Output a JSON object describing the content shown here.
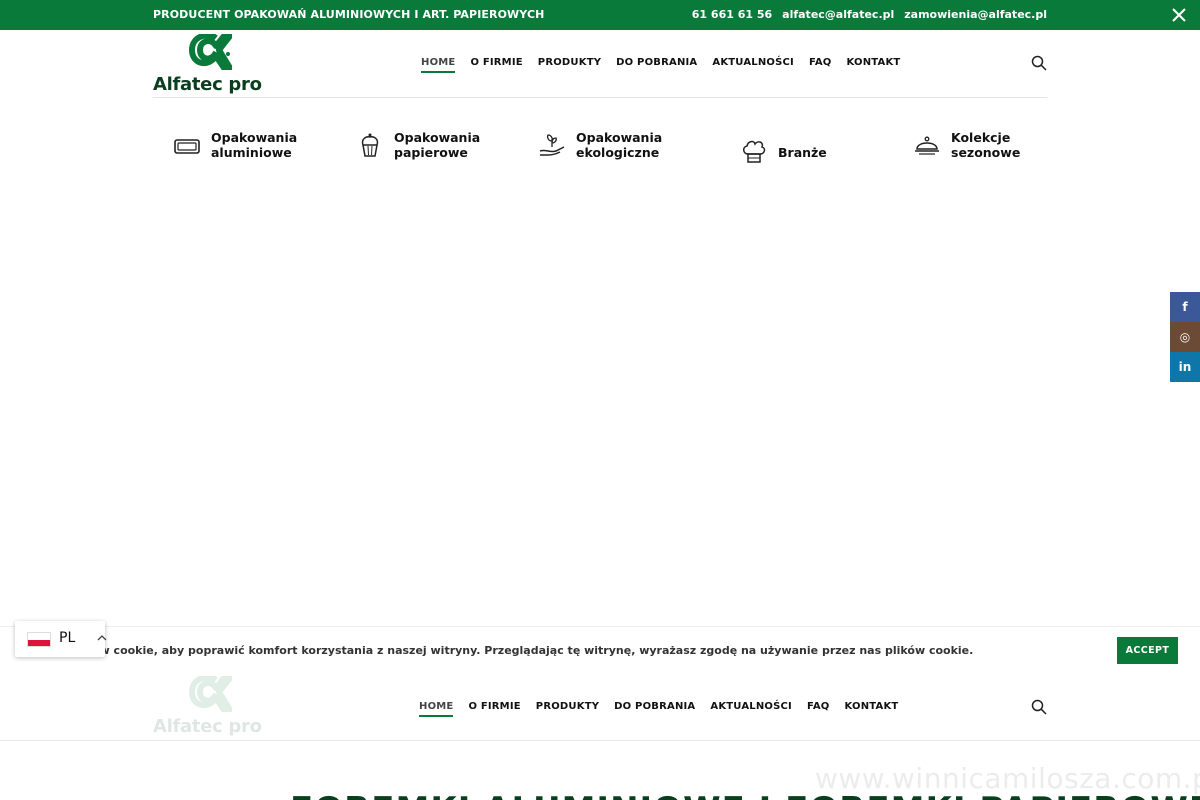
{
  "topbar": {
    "tagline": "PRODUCENT OPAKOWAŃ ALUMINIOWYCH I ART. PAPIEROWYCH",
    "phone": "61 661 61 56",
    "email1": "alfatec@alfatec.pl",
    "email2": "zamowienia@alfatec.pl",
    "close_icon": "close-icon"
  },
  "brand": {
    "name": "Alfatec pro",
    "primary_color": "#0a7a3a",
    "dark_color": "#0b3d1f"
  },
  "nav": {
    "items": [
      {
        "label": "HOME",
        "active": true
      },
      {
        "label": "O FIRMIE"
      },
      {
        "label": "PRODUKTY"
      },
      {
        "label": "DO POBRANIA"
      },
      {
        "label": "AKTUALNOŚCI"
      },
      {
        "label": "FAQ"
      },
      {
        "label": "KONTAKT"
      }
    ],
    "search_icon": "search-icon"
  },
  "categories": [
    {
      "line1": "Opakowania",
      "line2": "aluminiowe",
      "icon": "tray-icon"
    },
    {
      "line1": "Opakowania",
      "line2": "papierowe",
      "icon": "cupcake-icon"
    },
    {
      "line1": "Opakowania",
      "line2": "ekologiczne",
      "icon": "eco-hand-icon"
    },
    {
      "line1": "Branże",
      "line2": "",
      "icon": "chef-hat-icon"
    },
    {
      "line1": "Kolekcje",
      "line2": "sezonowe",
      "icon": "cloche-icon"
    }
  ],
  "social": [
    {
      "label": "f",
      "icon": "facebook-icon",
      "color": "#3b5998"
    },
    {
      "label": "◎",
      "icon": "instagram-icon",
      "color": "#6b4a36"
    },
    {
      "label": "in",
      "icon": "linkedin-icon",
      "color": "#0e76a8"
    }
  ],
  "cookie": {
    "message": "ów cookie, aby poprawić komfort korzystania z naszej witryny. Przeglądając tę witrynę, wyrażasz zgodę na używanie przez nas plików cookie.",
    "accept_label": "ACCEPT"
  },
  "language": {
    "code": "PL"
  },
  "watermark": "www.winnicamilosza.com.pl",
  "page_title_partial": "FOREMKI ALUMINIOWE I FOREMKI PAPIEROWE"
}
